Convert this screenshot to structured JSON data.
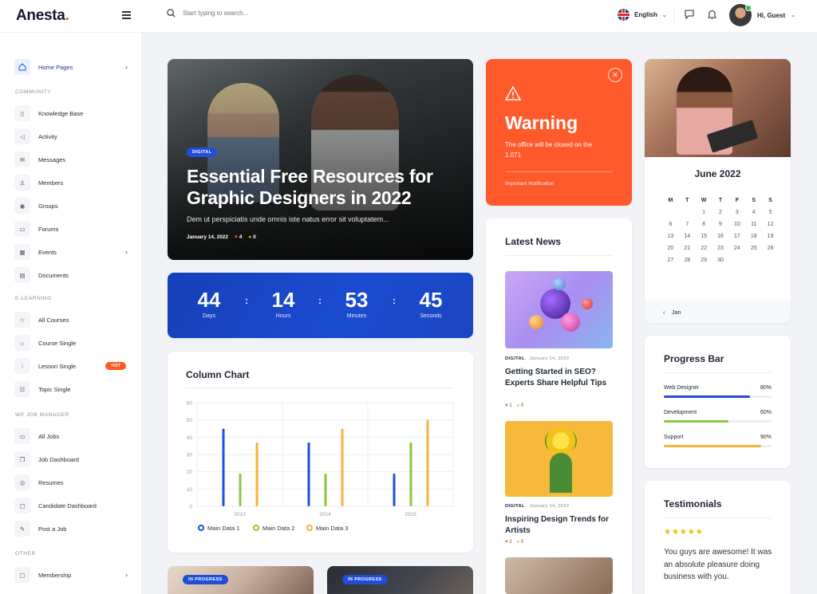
{
  "brand": {
    "name": "Anesta",
    "dot": ".",
    "accent": "#ff5a1f"
  },
  "topbar": {
    "search_placeholder": "Start typing to search...",
    "language": "English",
    "user_greeting": "Hi, Guest"
  },
  "sidebar": {
    "top": [
      {
        "label": "Home Pages",
        "icon": "home-icon"
      }
    ],
    "sections": [
      {
        "heading": "COMMUNITY",
        "items": [
          "Knowledge Base",
          "Activity",
          "Messages",
          "Members",
          "Groups",
          "Forums",
          "Events",
          "Documents"
        ]
      },
      {
        "heading": "E-LEARNING",
        "items": [
          "All Courses",
          "Course Single",
          "Lesson Single",
          "Topic Single"
        ]
      },
      {
        "heading": "WP JOB MANAGER",
        "items": [
          "All Jobs",
          "Job Dashboard",
          "Resumes",
          "Candidate Dashboard",
          "Post a Job"
        ]
      },
      {
        "heading": "OTHER",
        "items": [
          "Membership"
        ]
      }
    ],
    "hot_badge": "HOT"
  },
  "hero": {
    "category": "DIGITAL",
    "title": "Essential Free Resources for Graphic Designers in 2022",
    "excerpt": "Dem ut perspiciatis unde omnis iste natus error sit voluptatem...",
    "date": "January 14, 2022",
    "likes": "4",
    "comments": "0"
  },
  "countdown": [
    {
      "value": "44",
      "label": "Days"
    },
    {
      "value": "14",
      "label": "Hours"
    },
    {
      "value": "53",
      "label": "Minutes"
    },
    {
      "value": "45",
      "label": "Seconds"
    }
  ],
  "chart_title": "Column Chart",
  "chart_data": {
    "type": "bar",
    "categories": [
      "2013",
      "2014",
      "2015"
    ],
    "series": [
      {
        "name": "Main Data 1",
        "values": [
          45,
          37,
          19
        ],
        "color": "#1f4fd8"
      },
      {
        "name": "Main Data 2",
        "values": [
          19,
          19,
          37
        ],
        "color": "#8cc63f"
      },
      {
        "name": "Main Data 3",
        "values": [
          37,
          45,
          50
        ],
        "color": "#f7b23b"
      }
    ],
    "ylim": [
      0,
      60
    ],
    "yticks": [
      "60",
      "50",
      "40",
      "30",
      "20",
      "10",
      "0"
    ],
    "grid": true,
    "legend": "bottom"
  },
  "warning": {
    "title": "Warning",
    "message": "The office will be closed on the 1.071",
    "note": "Important Notification"
  },
  "news": {
    "title": "Latest News",
    "items": [
      {
        "category": "DIGITAL",
        "date": "January 14, 2022",
        "title": "Getting Started in SEO? Experts Share Helpful Tips",
        "likes": "1",
        "comments": "0"
      },
      {
        "category": "DIGITAL",
        "date": "January 14, 2022",
        "title": "Inspiring Design Trends for Artists",
        "likes": "2",
        "comments": "0"
      }
    ]
  },
  "calendar": {
    "month": "June 2022",
    "dow": [
      "M",
      "T",
      "W",
      "T",
      "F",
      "S",
      "S"
    ],
    "days": [
      "",
      "",
      "1",
      "2",
      "3",
      "4",
      "5",
      "6",
      "7",
      "8",
      "9",
      "10",
      "11",
      "12",
      "13",
      "14",
      "15",
      "16",
      "17",
      "18",
      "19",
      "20",
      "21",
      "22",
      "23",
      "24",
      "25",
      "26",
      "27",
      "28",
      "29",
      "30"
    ],
    "prev": "Jan"
  },
  "progress": {
    "title": "Progress Bar",
    "items": [
      {
        "label": "Web Designer",
        "value": "80%",
        "fraction": 0.8,
        "color": "#1f4fd8"
      },
      {
        "label": "Development",
        "value": "60%",
        "fraction": 0.6,
        "color": "#8cc63f"
      },
      {
        "label": "Support",
        "value": "90%",
        "fraction": 0.9,
        "color": "#f7b23b"
      }
    ]
  },
  "testimonials": {
    "title": "Testimonials",
    "stars": "★★★★★",
    "quote": "You guys are awesome! It was an absolute pleasure doing business with you."
  },
  "courses": [
    {
      "status": "IN PROGRESS"
    },
    {
      "status": "IN PROGRESS"
    }
  ]
}
